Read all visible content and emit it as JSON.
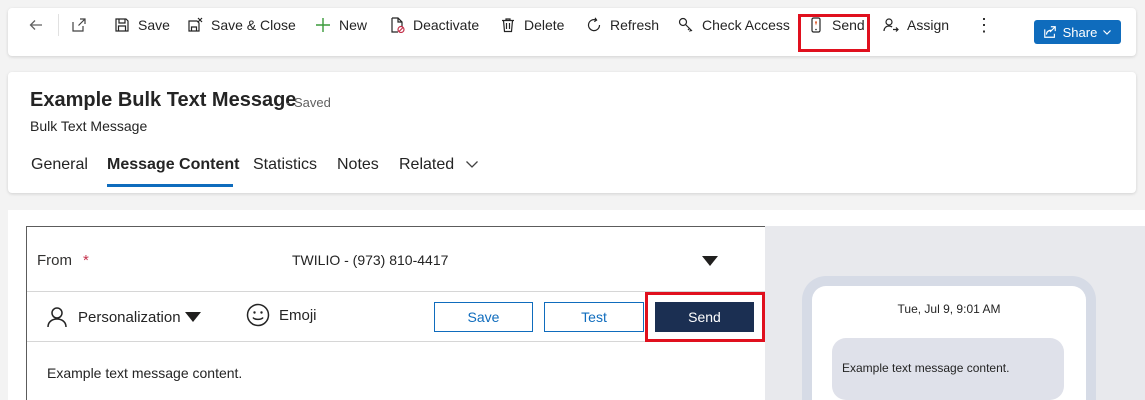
{
  "commandbar": {
    "items": [
      {
        "label": "",
        "icon": "back-arrow-icon"
      },
      {
        "label": "",
        "icon": "open-in-new-window-icon"
      },
      {
        "label": "Save",
        "icon": "save-icon"
      },
      {
        "label": "Save & Close",
        "icon": "save-close-icon"
      },
      {
        "label": "New",
        "icon": "plus-icon"
      },
      {
        "label": "Deactivate",
        "icon": "deactivate-icon"
      },
      {
        "label": "Delete",
        "icon": "trash-icon"
      },
      {
        "label": "Refresh",
        "icon": "refresh-icon"
      },
      {
        "label": "Check Access",
        "icon": "key-icon"
      },
      {
        "label": "Send",
        "icon": "mobile-send-icon"
      },
      {
        "label": "Assign",
        "icon": "assign-person-icon"
      },
      {
        "label": "⋮",
        "icon": "more-icon"
      }
    ],
    "share_label": "Share",
    "highlight_color": "#e0101e",
    "accent": "#0f6cbd"
  },
  "record": {
    "title": "Example Bulk Text Message",
    "status": "- Saved",
    "entity": "Bulk Text Message"
  },
  "tabs": [
    {
      "label": "General"
    },
    {
      "label": "Message Content"
    },
    {
      "label": "Statistics"
    },
    {
      "label": "Notes"
    },
    {
      "label": "Related"
    }
  ],
  "editor": {
    "from_label": "From",
    "required_marker": "*",
    "from_value": "TWILIO - (973) 810-4417",
    "personalization_label": "Personalization",
    "emoji_label": "Emoji",
    "save_label": "Save",
    "test_label": "Test",
    "send_label": "Send",
    "message_text": "Example text message content.",
    "send_color": "#1b2f52"
  },
  "preview": {
    "timestamp": "Tue, Jul 9, 9:01 AM",
    "bubble_text": "Example text message content."
  }
}
